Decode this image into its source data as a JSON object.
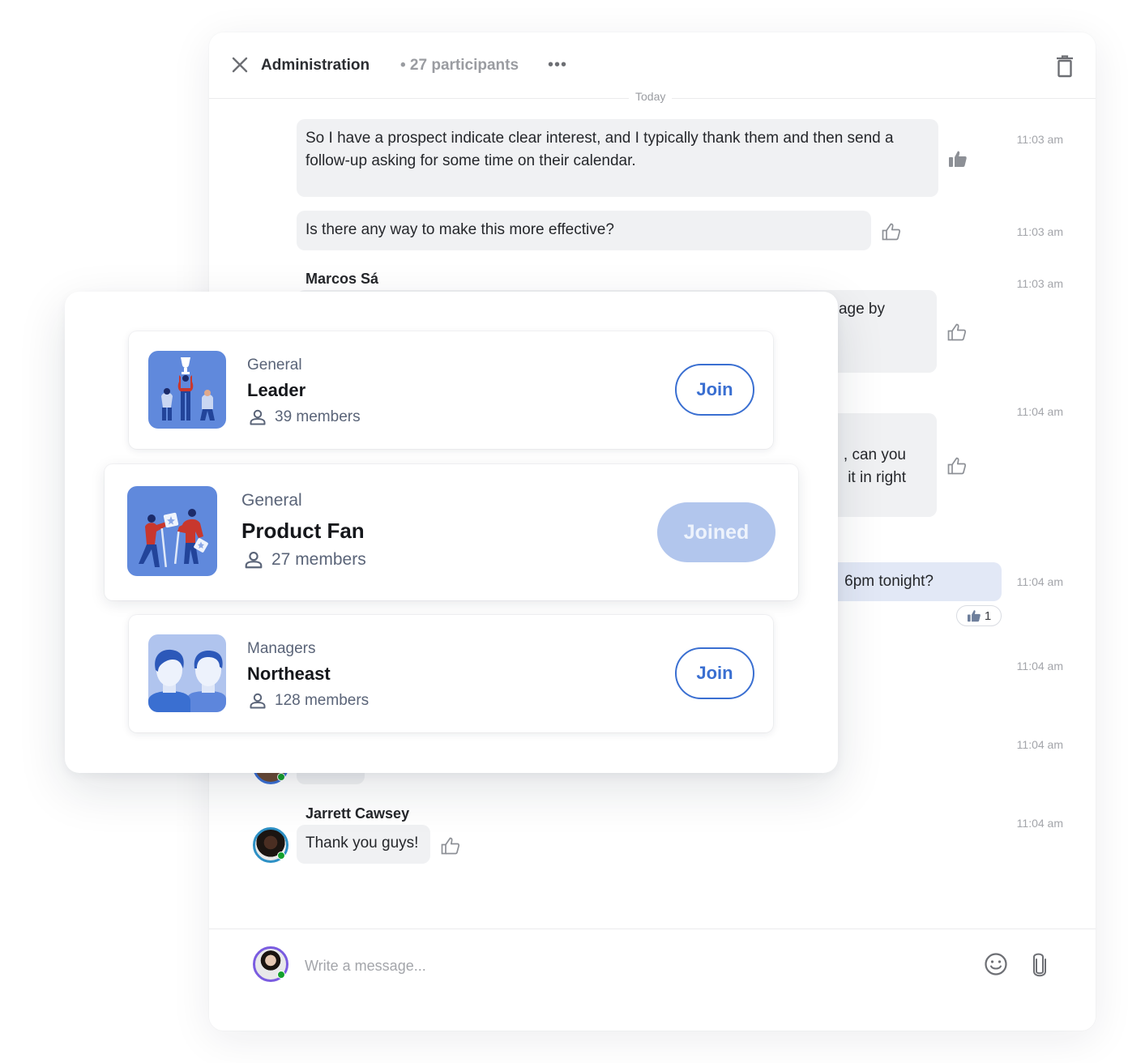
{
  "chat": {
    "title": "Administration",
    "participants": "• 27 participants",
    "more_label": "•••",
    "date_separator": "Today",
    "messages": [
      {
        "text": "So I have a prospect indicate clear interest, and I typically thank them and then send a follow-up asking for some time on their calendar.",
        "time": "11:03 am",
        "liked": true
      },
      {
        "text": "Is there any way to make this more effective?",
        "time": "11:03 am",
        "liked": false
      },
      {
        "sender": "Marcos Sá",
        "text": "age by",
        "time": "11:03 am",
        "liked": false
      },
      {
        "text": ", can you\n it in right",
        "time": "11:04 am",
        "liked": false
      },
      {
        "text": "6pm tonight?",
        "time": "11:04 am",
        "reaction_count": "1"
      },
      {
        "time": "11:04 am"
      },
      {
        "time": "11:04 am"
      },
      {
        "sender": "Jarrett Cawsey",
        "text": "Thank you guys!",
        "time": "11:04 am",
        "liked": false
      }
    ],
    "composer": {
      "placeholder": "Write a message..."
    }
  },
  "groups": [
    {
      "category": "General",
      "name": "Leader",
      "members": "39 members",
      "action": "Join",
      "joined": false
    },
    {
      "category": "General",
      "name": "Product Fan",
      "members": "27 members",
      "action": "Joined",
      "joined": true
    },
    {
      "category": "Managers",
      "name": "Northeast",
      "members": "128 members",
      "action": "Join",
      "joined": false
    }
  ],
  "colors": {
    "accent": "#3a6fd1",
    "joined_bg": "#b2c6ed",
    "bubble": "#f0f1f3",
    "bubble_own": "#e2e8f6",
    "online": "#15a02d"
  }
}
